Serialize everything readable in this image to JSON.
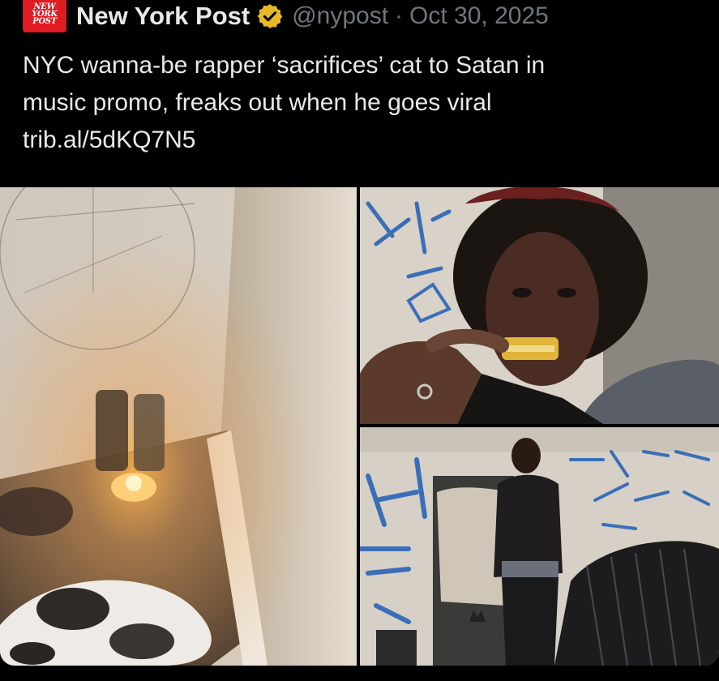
{
  "post": {
    "author": {
      "display_name": "New York Post",
      "handle": "@nypost",
      "verified_icon": "verified-badge-icon",
      "avatar_text": "NEW YORK POST",
      "brand_color": "#e01b22"
    },
    "separator": "·",
    "date": "Oct 30, 2025",
    "text_lines": [
      "NYC wanna-be rapper ‘sacrifices’ cat to Satan in",
      "music promo, freaks out when he goes viral",
      "trib.al/5dKQ7N5"
    ],
    "media": {
      "count": 3
    }
  },
  "colors": {
    "background": "#000000",
    "text_primary": "#e7e9ea",
    "text_secondary": "#71767b",
    "verified_gold": "#e8b829"
  }
}
